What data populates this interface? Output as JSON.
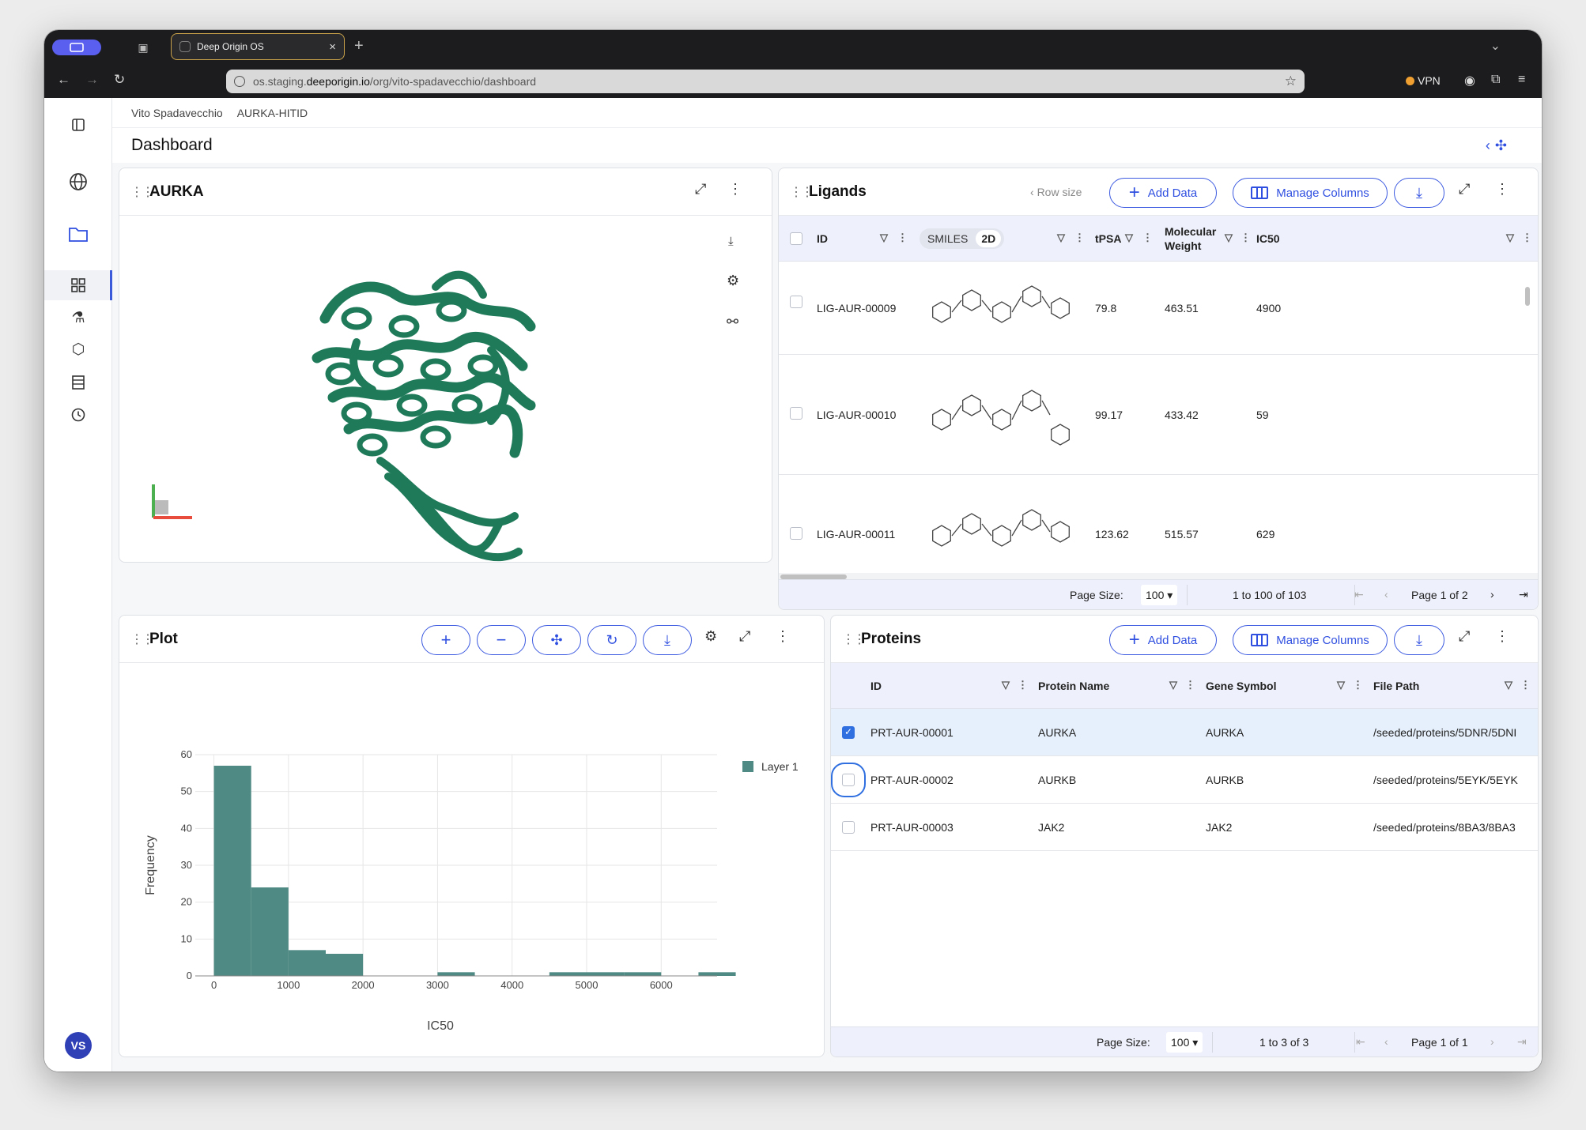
{
  "browser": {
    "tab_title": "Deep Origin OS",
    "url_host_prefix": "os.staging.",
    "url_host": "deeporigin.io",
    "url_path": "/org/vito-spadavecchio/dashboard",
    "vpn_label": "VPN"
  },
  "breadcrumb": {
    "org": "Vito Spadavecchio",
    "project": "AURKA-HITID"
  },
  "page": {
    "title": "Dashboard"
  },
  "user": {
    "initials": "VS"
  },
  "viewer": {
    "title": "AURKA",
    "protein_color": "#1f7a5a"
  },
  "ligands": {
    "title": "Ligands",
    "row_size_label": "Row size",
    "add_label": "Add Data",
    "manage_label": "Manage Columns",
    "columns": {
      "id": "ID",
      "smiles": "SMILES",
      "smiles_2d": "2D",
      "tpsa": "tPSA",
      "mw_line1": "Molecular",
      "mw_line2": "Weight",
      "ic50": "IC50"
    },
    "rows": [
      {
        "id": "LIG-AUR-00009",
        "tpsa": "79.8",
        "mw": "463.51",
        "ic50": "4900"
      },
      {
        "id": "LIG-AUR-00010",
        "tpsa": "99.17",
        "mw": "433.42",
        "ic50": "59"
      },
      {
        "id": "LIG-AUR-00011",
        "tpsa": "123.62",
        "mw": "515.57",
        "ic50": "629"
      }
    ],
    "footer": {
      "page_size_label": "Page Size:",
      "page_size": "100",
      "range": "1 to 100 of 103",
      "page": "Page 1 of 2"
    }
  },
  "plot": {
    "title": "Plot"
  },
  "proteins": {
    "title": "Proteins",
    "add_label": "Add Data",
    "manage_label": "Manage Columns",
    "columns": {
      "id": "ID",
      "name": "Protein Name",
      "gene": "Gene Symbol",
      "path": "File Path"
    },
    "rows": [
      {
        "id": "PRT-AUR-00001",
        "name": "AURKA",
        "gene": "AURKA",
        "path": "/seeded/proteins/5DNR/5DNI",
        "checked": true
      },
      {
        "id": "PRT-AUR-00002",
        "name": "AURKB",
        "gene": "AURKB",
        "path": "/seeded/proteins/5EYK/5EYK",
        "checked": false
      },
      {
        "id": "PRT-AUR-00003",
        "name": "JAK2",
        "gene": "JAK2",
        "path": "/seeded/proteins/8BA3/8BA3",
        "checked": false
      }
    ],
    "footer": {
      "page_size_label": "Page Size:",
      "page_size": "100",
      "range": "1 to 3 of 3",
      "page": "Page 1 of 1"
    }
  },
  "chart_data": {
    "type": "bar",
    "xlabel": "IC50",
    "ylabel": "Frequency",
    "legend": "Layer 1",
    "legend_position": "top-right",
    "color": "#4f8a84",
    "bin_width": 500,
    "bins": [
      {
        "x0": 0,
        "x1": 500,
        "y": 57
      },
      {
        "x0": 500,
        "x1": 1000,
        "y": 24
      },
      {
        "x0": 1000,
        "x1": 1500,
        "y": 7
      },
      {
        "x0": 1500,
        "x1": 2000,
        "y": 6
      },
      {
        "x0": 2000,
        "x1": 2500,
        "y": 0
      },
      {
        "x0": 2500,
        "x1": 3000,
        "y": 0
      },
      {
        "x0": 3000,
        "x1": 3500,
        "y": 1
      },
      {
        "x0": 3500,
        "x1": 4000,
        "y": 0
      },
      {
        "x0": 4000,
        "x1": 4500,
        "y": 0
      },
      {
        "x0": 4500,
        "x1": 5000,
        "y": 1
      },
      {
        "x0": 5000,
        "x1": 5500,
        "y": 1
      },
      {
        "x0": 5500,
        "x1": 6000,
        "y": 1
      },
      {
        "x0": 6000,
        "x1": 6500,
        "y": 0
      },
      {
        "x0": 6500,
        "x1": 7000,
        "y": 1
      }
    ],
    "xlim": [
      -250,
      6750
    ],
    "ylim": [
      0,
      60
    ],
    "xticks": [
      0,
      1000,
      2000,
      3000,
      4000,
      5000,
      6000
    ],
    "yticks": [
      0,
      10,
      20,
      30,
      40,
      50,
      60
    ],
    "grid": true
  }
}
